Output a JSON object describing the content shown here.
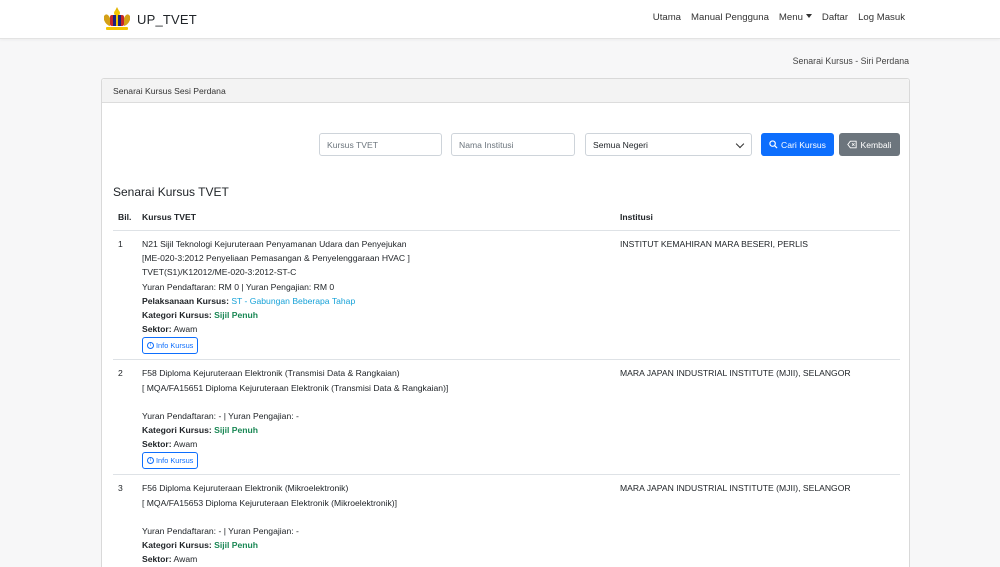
{
  "brand": {
    "name": "UP_TVET"
  },
  "nav": {
    "items": [
      "Utama",
      "Manual Pengguna",
      "Menu",
      "Daftar",
      "Log Masuk"
    ]
  },
  "breadcrumb": "Senarai Kursus - Siri Perdana",
  "card": {
    "header": "Senarai Kursus Sesi Perdana",
    "filters": {
      "course_placeholder": "Kursus TVET",
      "institution_placeholder": "Nama Institusi",
      "state_selected": "Semua Negeri",
      "search_label": "Cari Kursus",
      "back_label": "Kembali"
    },
    "list_title": "Senarai Kursus TVET",
    "columns": [
      "Bil.",
      "Kursus TVET",
      "Institusi"
    ],
    "info_label": "Info Kursus",
    "labels": {
      "pelaksanaan": "Pelaksanaan Kursus:",
      "kategori": "Kategori Kursus:",
      "sektor": "Sektor:"
    },
    "rows": [
      {
        "no": "1",
        "line1": "N21 Sijil Teknologi Kejuruteraan Penyamanan Udara dan Penyejukan",
        "line2": "[ME-020-3:2012 Penyeliaan Pemasangan & Penyelenggaraan HVAC ]",
        "line3": "TVET(S1)/K12012/ME-020-3:2012-ST-C",
        "fees": "Yuran Pendaftaran: RM 0 | Yuran Pengajian: RM 0",
        "pelaksanaan": "ST - Gabungan Beberapa Tahap",
        "kategori": "Sijil Penuh",
        "sektor": "Awam",
        "institution": "INSTITUT KEMAHIRAN MARA BESERI, PERLIS"
      },
      {
        "no": "2",
        "line1": "F58 Diploma Kejuruteraan Elektronik (Transmisi Data & Rangkaian)",
        "line2": "[ MQA/FA15651 Diploma Kejuruteraan Elektronik (Transmisi Data & Rangkaian)]",
        "fees": "Yuran Pendaftaran: - | Yuran Pengajian: -",
        "kategori": "Sijil Penuh",
        "sektor": "Awam",
        "institution": "MARA JAPAN INDUSTRIAL INSTITUTE (MJII), SELANGOR"
      },
      {
        "no": "3",
        "line1": "F56 Diploma Kejuruteraan Elektronik (Mikroelektronik)",
        "line2": "[ MQA/FA15653 Diploma Kejuruteraan Elektronik (Mikroelektronik)]",
        "fees": "Yuran Pendaftaran: - | Yuran Pengajian: -",
        "kategori": "Sijil Penuh",
        "sektor": "Awam",
        "institution": "MARA JAPAN INDUSTRIAL INSTITUTE (MJII), SELANGOR"
      }
    ]
  },
  "colors": {
    "primary": "#0d6efd",
    "secondary": "#6c757d",
    "success": "#198754",
    "info": "#17a2d8"
  }
}
